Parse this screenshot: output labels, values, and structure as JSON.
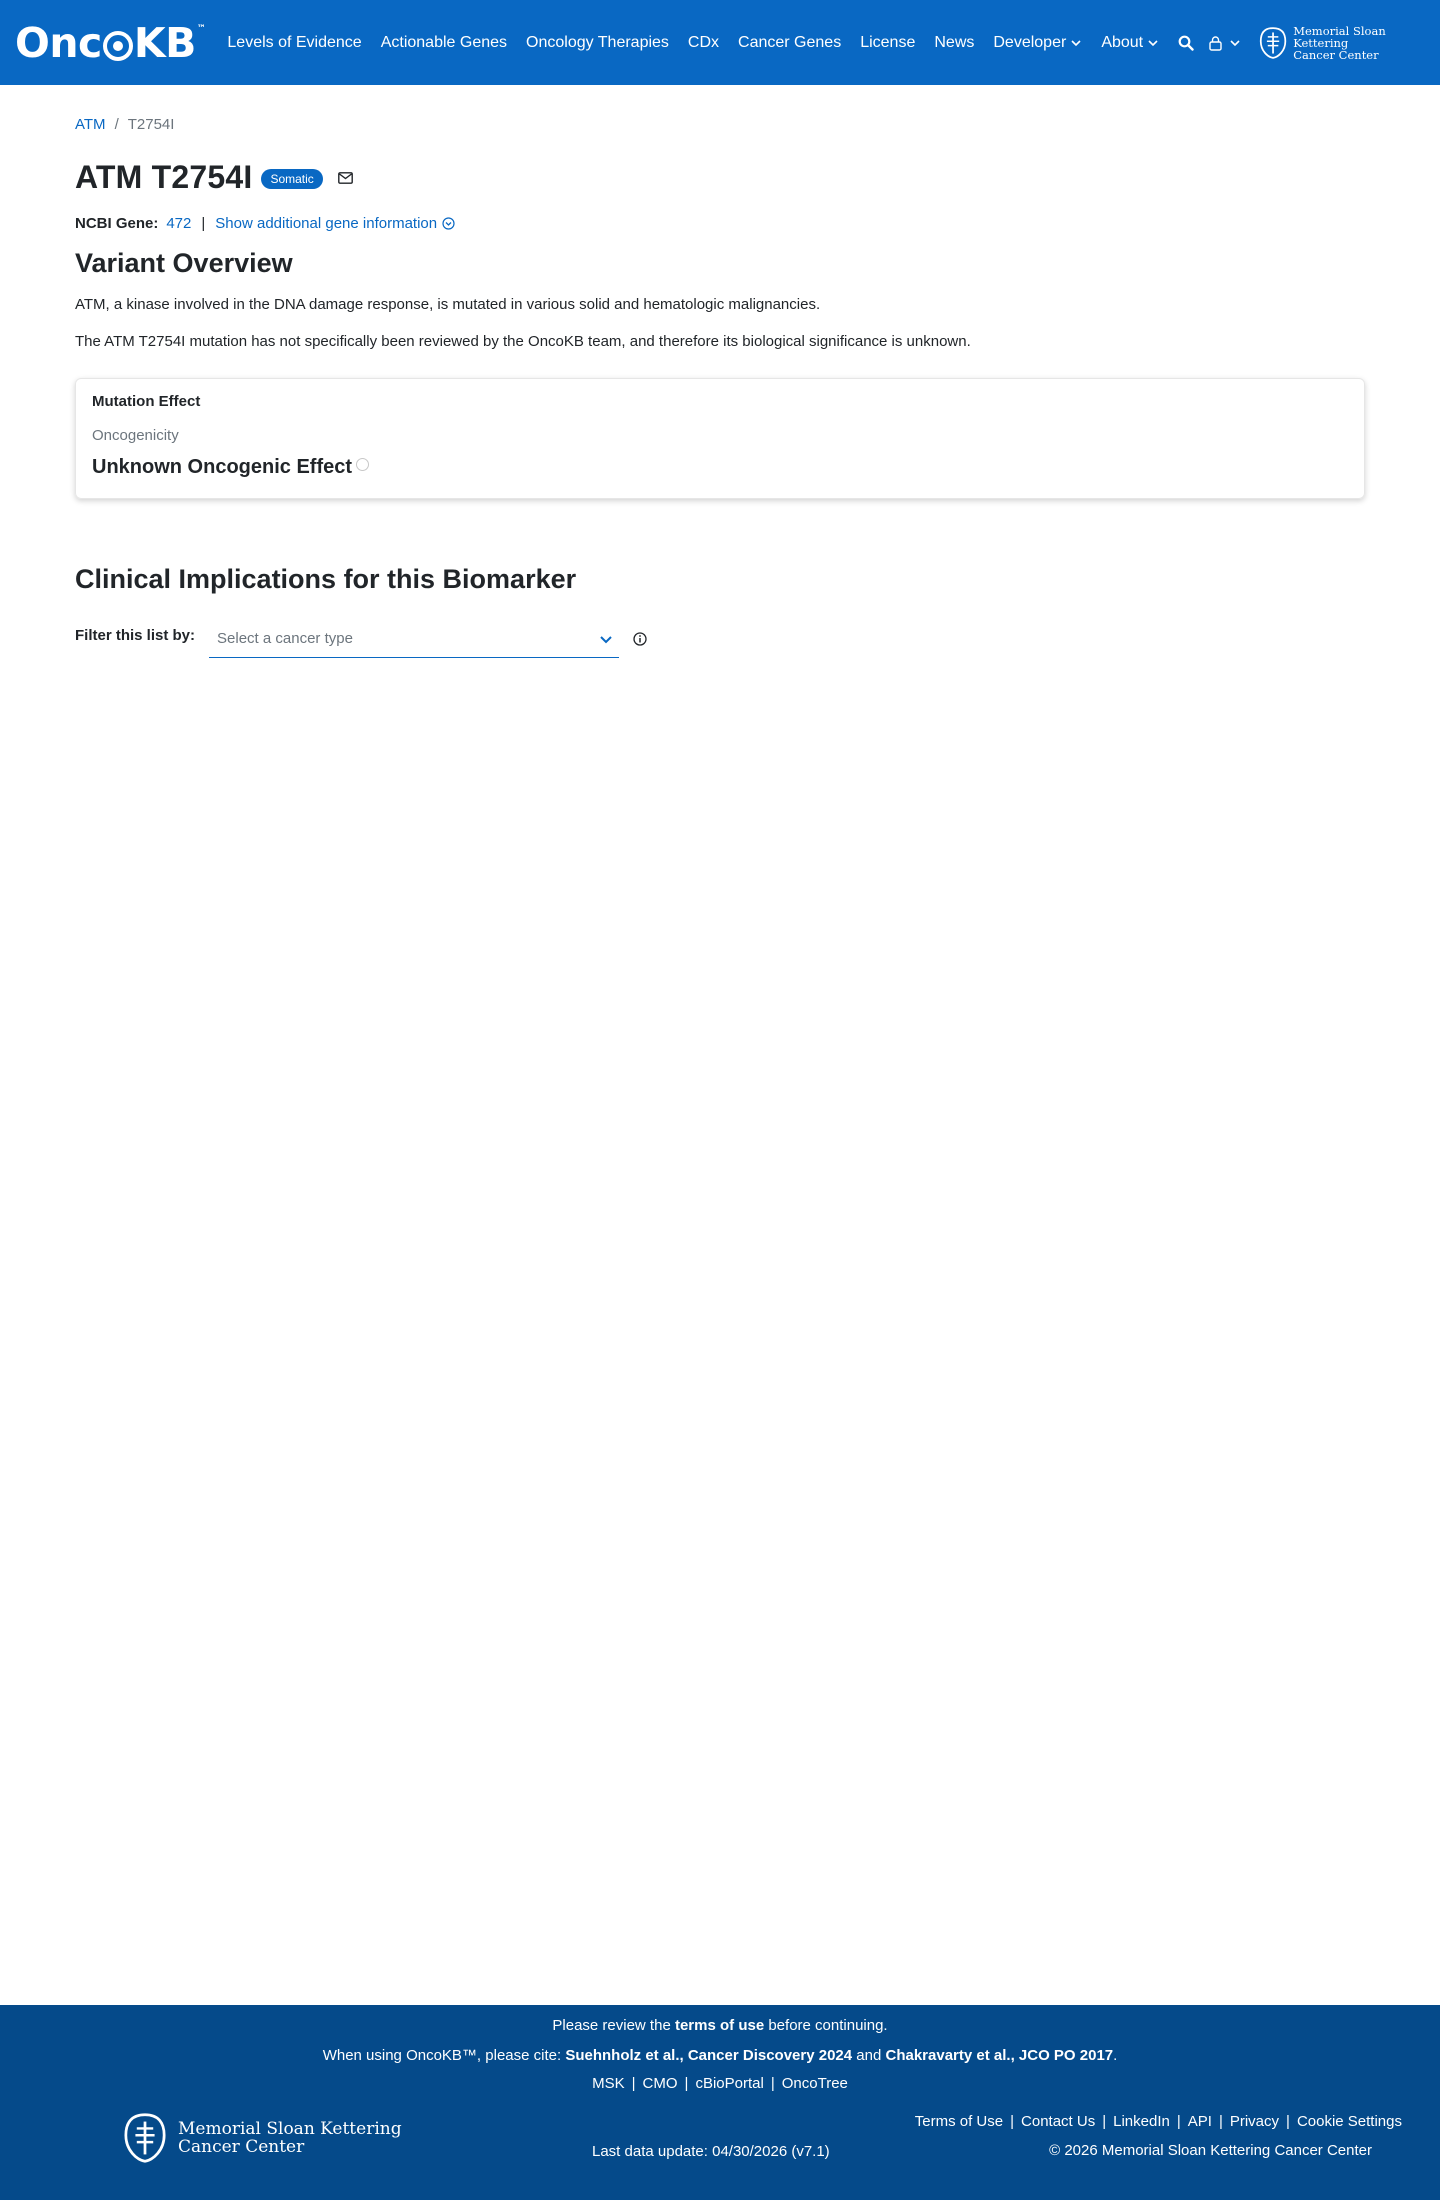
{
  "header": {
    "brand": {
      "prefix": "Onc",
      "suffix": "KB",
      "tm": "™"
    },
    "nav": [
      {
        "label": "Levels of Evidence"
      },
      {
        "label": "Actionable Genes"
      },
      {
        "label": "Oncology Therapies"
      },
      {
        "label": "CDx"
      },
      {
        "label": "Cancer Genes"
      },
      {
        "label": "License"
      },
      {
        "label": "News"
      },
      {
        "label": "Developer"
      },
      {
        "label": "About"
      }
    ],
    "msk": {
      "line1": "Memorial Sloan Kettering",
      "line2": "Cancer Center"
    }
  },
  "breadcrumb": {
    "gene": "ATM",
    "separator": "/",
    "current": "T2754I"
  },
  "title": {
    "text": "ATM T2754I",
    "badge": "Somatic"
  },
  "gene_info": {
    "label": "NCBI Gene:",
    "id": "472",
    "separator": "|",
    "more": "Show additional gene information"
  },
  "overview": {
    "heading": "Variant Overview",
    "paragraphs": [
      "ATM, a kinase involved in the DNA damage response, is mutated in various solid and hematologic malignancies.",
      "The ATM T2754I mutation has not specifically been reviewed by the OncoKB team, and therefore its biological significance is unknown."
    ]
  },
  "mutation_effect": {
    "title": "Mutation Effect",
    "label": "Oncogenicity",
    "value": "Unknown Oncogenic Effect"
  },
  "clinical": {
    "heading": "Clinical Implications for this Biomarker",
    "filter_label": "Filter this list by:",
    "select_placeholder": "Select a cancer type"
  },
  "footer": {
    "review": {
      "pre": "Please review the",
      "link": "terms of use",
      "post": "before continuing."
    },
    "cite": {
      "pre": "When using OncoKB™, please cite:",
      "ref1": "Suehnholz et al., Cancer Discovery 2024",
      "and": "and",
      "ref2": "Chakravarty et al., JCO PO 2017",
      "end": "."
    },
    "resources": [
      "MSK",
      "CMO",
      "cBioPortal",
      "OncoTree"
    ],
    "msk": {
      "line1": "Memorial Sloan Kettering",
      "line2": "Cancer Center"
    },
    "last_update": "Last data update: 04/30/2026 (v7.1)",
    "links": [
      "Terms of Use",
      "Contact Us",
      "LinkedIn",
      "API",
      "Privacy",
      "Cookie Settings"
    ],
    "copyright": "© 2026 Memorial Sloan Kettering Cancer Center"
  },
  "colors": {
    "primary": "#0968c3",
    "footer": "#054a8a",
    "muted": "#6c757d"
  }
}
